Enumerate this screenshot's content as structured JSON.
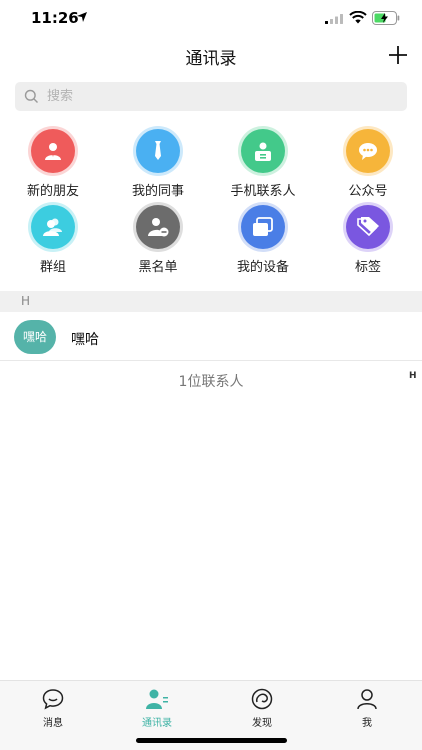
{
  "status_bar": {
    "time": "11:26"
  },
  "nav": {
    "title": "通讯录"
  },
  "search": {
    "placeholder": "搜索"
  },
  "shortcuts": [
    {
      "label": "新的朋友",
      "icon": "new-friend-icon",
      "color": "#ef5b5b"
    },
    {
      "label": "我的同事",
      "icon": "colleague-tie-icon",
      "color": "#4ab0f2"
    },
    {
      "label": "手机联系人",
      "icon": "phone-contact-icon",
      "color": "#43c98a"
    },
    {
      "label": "公众号",
      "icon": "chat-bubble-icon",
      "color": "#f6b53a"
    },
    {
      "label": "群组",
      "icon": "group-icon",
      "color": "#3ccde0"
    },
    {
      "label": "黑名单",
      "icon": "blacklist-icon",
      "color": "#6c6c6c"
    },
    {
      "label": "我的设备",
      "icon": "device-icon",
      "color": "#4a7ee6"
    },
    {
      "label": "标签",
      "icon": "tag-icon",
      "color": "#7a57e0"
    }
  ],
  "section": {
    "letter": "H"
  },
  "contacts": [
    {
      "avatar_text": "嘿哈",
      "name": "嘿哈"
    }
  ],
  "contact_count": "1位联系人",
  "index_bar": {
    "letter": "H"
  },
  "tabs": [
    {
      "label": "消息",
      "icon": "message-icon",
      "active": false
    },
    {
      "label": "通讯录",
      "icon": "contacts-icon",
      "active": true
    },
    {
      "label": "发现",
      "icon": "discover-icon",
      "active": false
    },
    {
      "label": "我",
      "icon": "profile-icon",
      "active": false
    }
  ],
  "colors": {
    "accent": "#3fb3a5",
    "avatar": "#55b3a9"
  }
}
